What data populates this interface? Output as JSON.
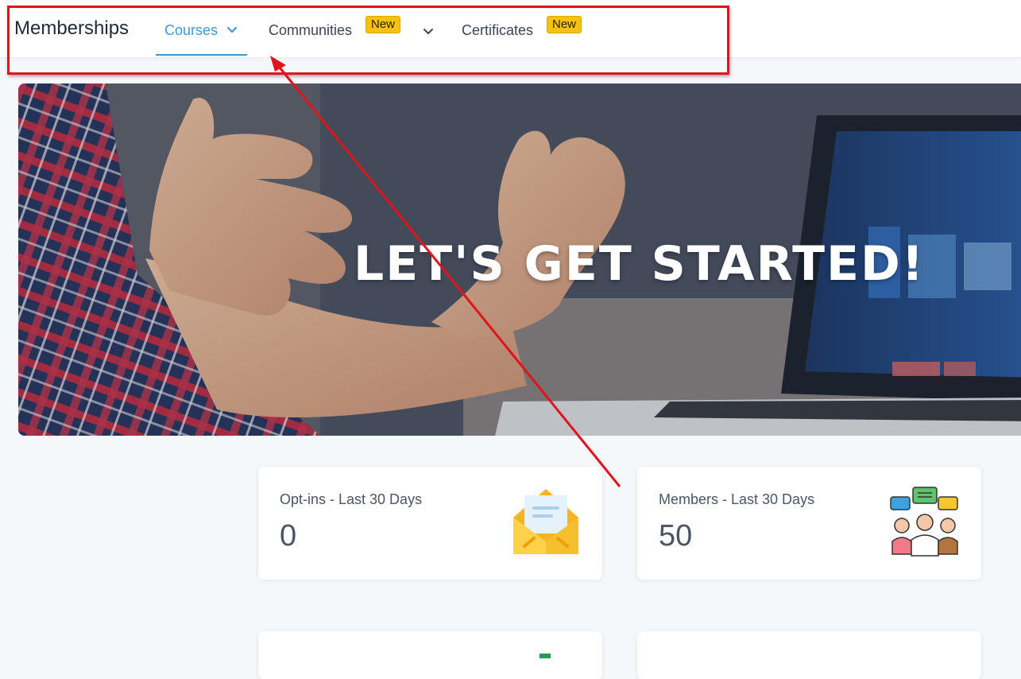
{
  "header": {
    "brand": "Memberships",
    "tabs": [
      {
        "label": "Courses",
        "active": true
      },
      {
        "label": "Communities",
        "badge": "New"
      },
      {
        "label": "Certificates",
        "badge": "New"
      }
    ]
  },
  "hero": {
    "title": "LET'S GET STARTED!"
  },
  "stats": [
    {
      "label": "Opt-ins - Last 30 Days",
      "value": "0",
      "icon": "envelope-icon"
    },
    {
      "label": "Members - Last 30 Days",
      "value": "50",
      "icon": "community-people-icon"
    }
  ],
  "colors": {
    "accent": "#3a9ad9",
    "badge": "#f7c10f",
    "annotation": "#e0141b"
  }
}
